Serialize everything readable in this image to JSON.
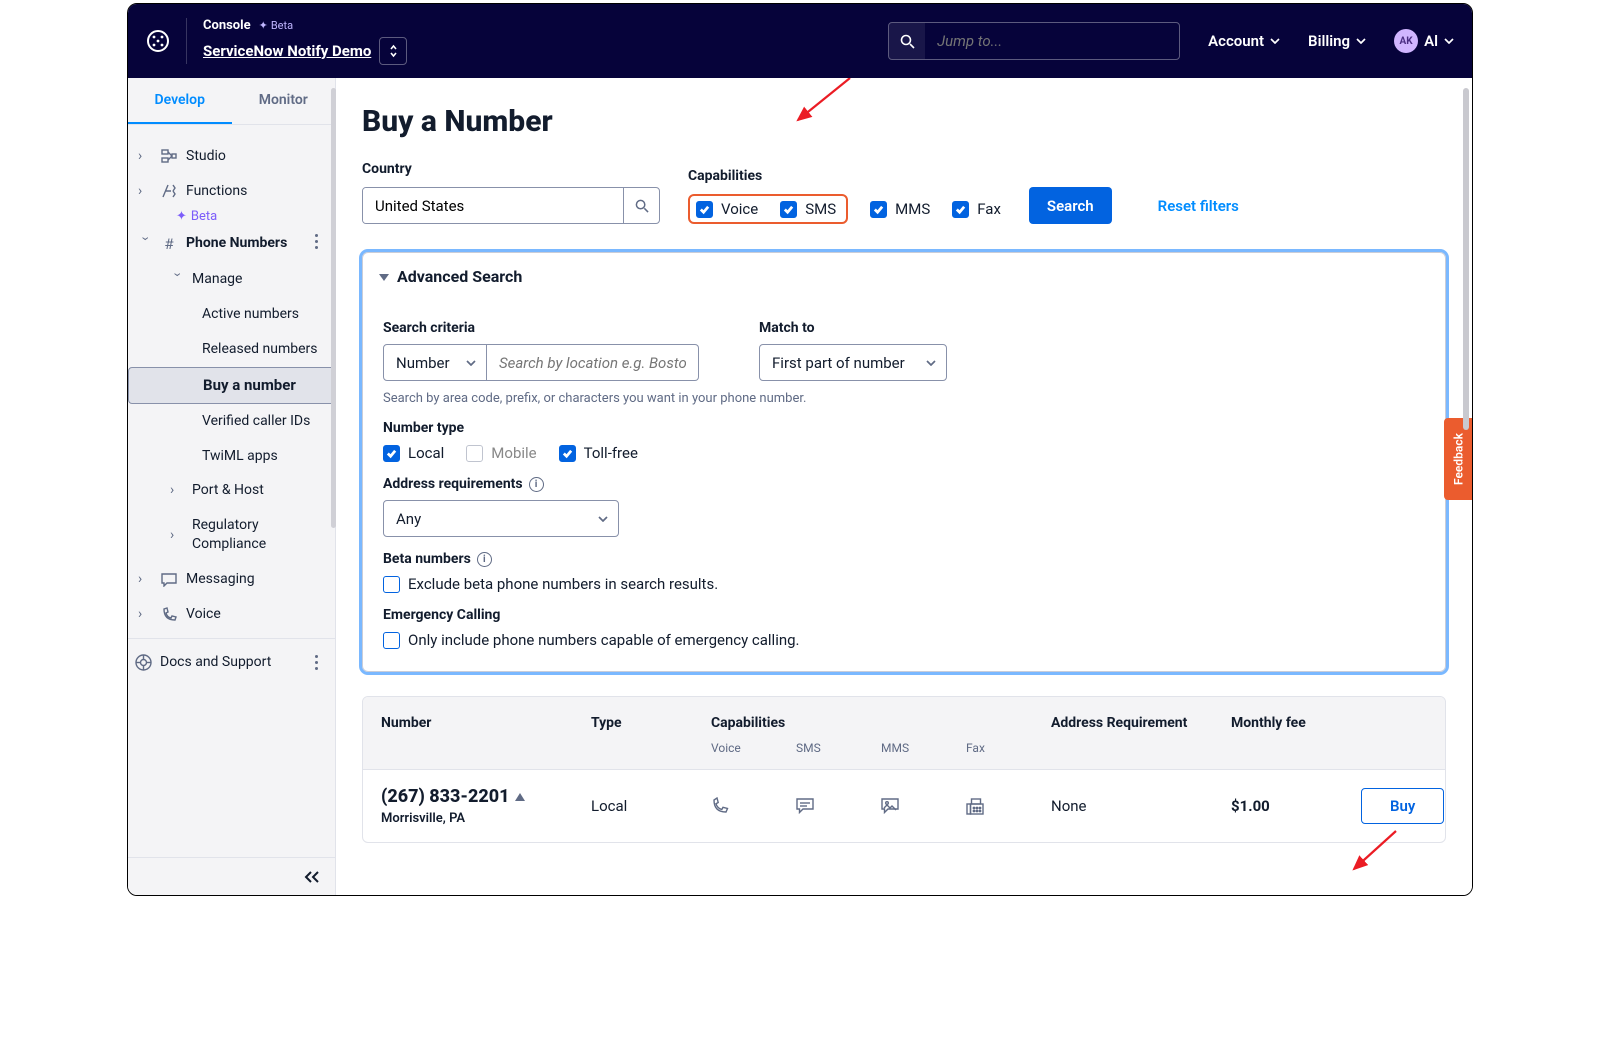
{
  "header": {
    "console": "Console",
    "beta": "Beta",
    "project": "ServiceNow Notify Demo",
    "search_placeholder": "Jump to...",
    "account": "Account",
    "billing": "Billing",
    "user_initials": "AK",
    "user_name": "Al"
  },
  "sidebar": {
    "tabs": {
      "develop": "Develop",
      "monitor": "Monitor"
    },
    "studio": "Studio",
    "functions": "Functions",
    "beta": "Beta",
    "phone_numbers": "Phone Numbers",
    "manage": "Manage",
    "active": "Active numbers",
    "released": "Released numbers",
    "buy": "Buy a number",
    "verified": "Verified caller IDs",
    "twiml": "TwiML apps",
    "port": "Port & Host",
    "reg": "Regulatory Compliance",
    "messaging": "Messaging",
    "voice": "Voice",
    "docs": "Docs and Support"
  },
  "main": {
    "title": "Buy a Number",
    "country_label": "Country",
    "country_value": "United States",
    "caps_label": "Capabilities",
    "cap_voice": "Voice",
    "cap_sms": "SMS",
    "cap_mms": "MMS",
    "cap_fax": "Fax",
    "search_btn": "Search",
    "reset": "Reset filters",
    "adv_title": "Advanced Search",
    "criteria_label": "Search criteria",
    "criteria_value": "Number",
    "loc_placeholder": "Search by location e.g. Boston",
    "match_label": "Match to",
    "match_value": "First part of number",
    "hint": "Search by area code, prefix, or characters you want in your phone number.",
    "numtype_label": "Number type",
    "nt_local": "Local",
    "nt_mobile": "Mobile",
    "nt_toll": "Toll-free",
    "addr_label": "Address requirements",
    "addr_value": "Any",
    "beta_label": "Beta numbers",
    "beta_opt": "Exclude beta phone numbers in search results.",
    "emerg_label": "Emergency Calling",
    "emerg_opt": "Only include phone numbers capable of emergency calling."
  },
  "table": {
    "h_number": "Number",
    "h_type": "Type",
    "h_caps": "Capabilities",
    "h_addr": "Address Requirement",
    "h_fee": "Monthly fee",
    "sub_voice": "Voice",
    "sub_sms": "SMS",
    "sub_mms": "MMS",
    "sub_fax": "Fax",
    "row": {
      "number": "(267) 833-2201",
      "loc": "Morrisville, PA",
      "type": "Local",
      "addr": "None",
      "fee": "$1.00",
      "buy": "Buy"
    }
  },
  "feedback": "Feedback"
}
